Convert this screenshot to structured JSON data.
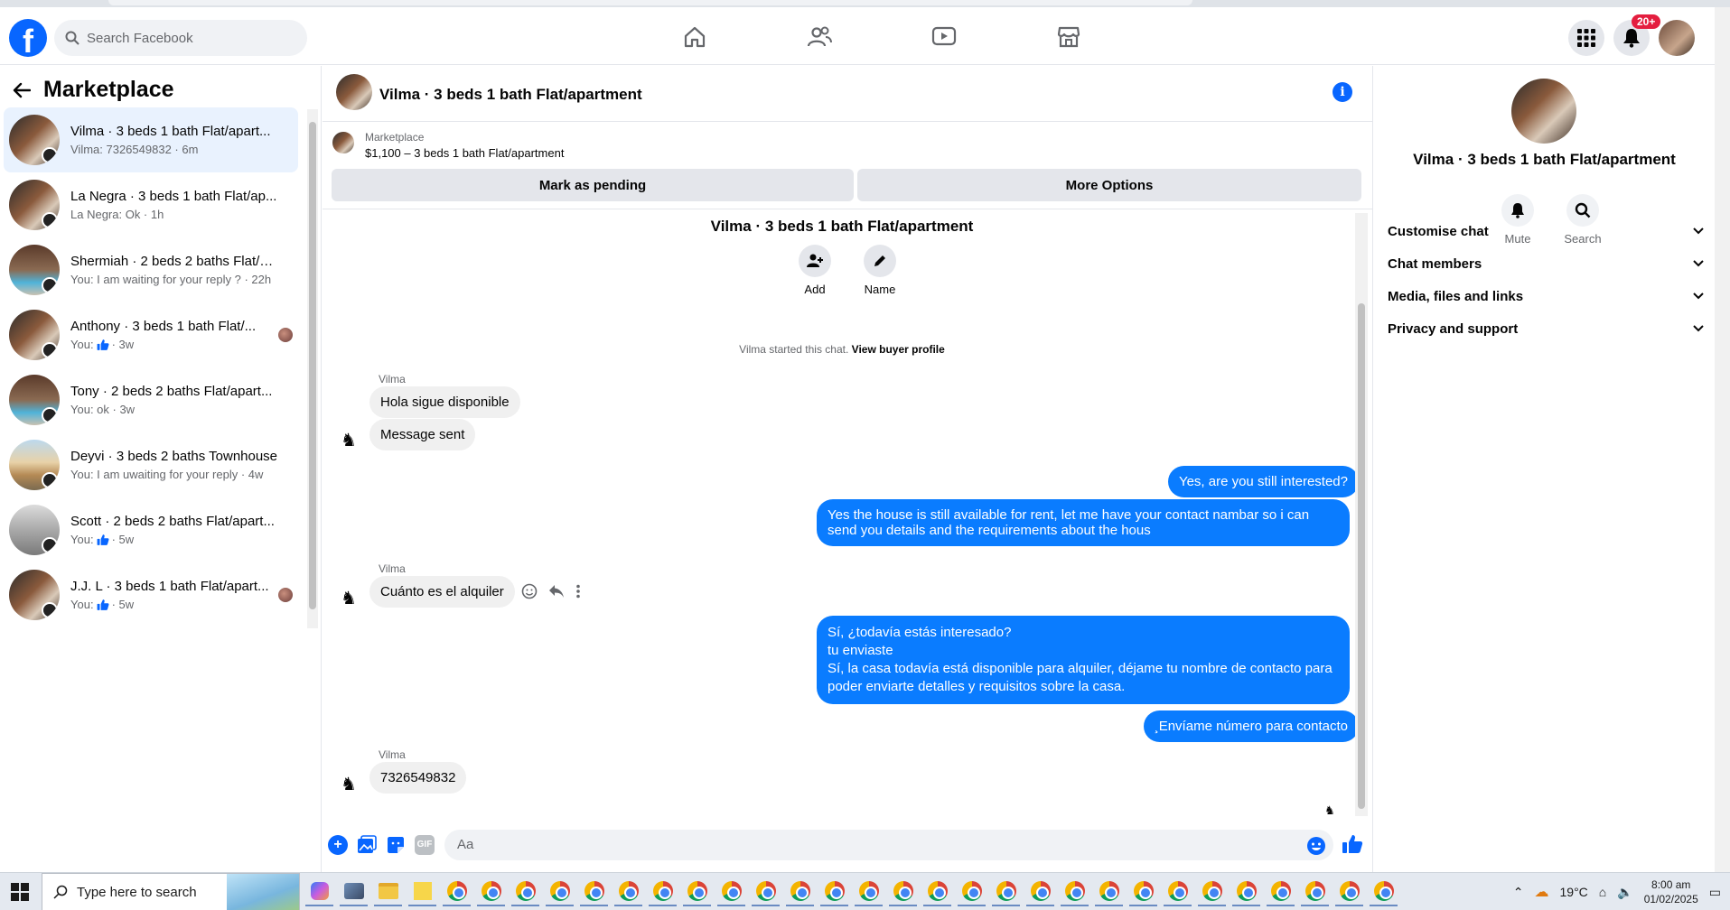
{
  "header": {
    "search_placeholder": "Search Facebook",
    "notif_badge": "20+"
  },
  "left": {
    "title": "Marketplace",
    "conversations": [
      {
        "name": "Vilma · 3 beds 1 bath Flat/apart...",
        "sub": "Vilma: 7326549832 · 6m",
        "active": true
      },
      {
        "name": "La Negra · 3 beds 1 bath Flat/ap...",
        "sub": "La Negra: Ok · 1h"
      },
      {
        "name": "Shermiah · 2 beds 2 baths Flat/a...",
        "sub": "You: I am waiting for your reply ? · 22h"
      },
      {
        "name": "Anthony · 3 beds 1 bath Flat/...",
        "sub_prefix": "You:",
        "sub": "· 3w"
      },
      {
        "name": "Tony · 2 beds 2 baths Flat/apart...",
        "sub": "You: ok · 3w"
      },
      {
        "name": "Deyvi · 3 beds 2 baths Townhouse",
        "sub": "You: I am uwaiting for your reply · 4w"
      },
      {
        "name": "Scott · 2 beds 2 baths Flat/apart...",
        "sub_prefix": "You:",
        "sub": "· 5w"
      },
      {
        "name": "J.J. L · 3 beds 1 bath Flat/apart...",
        "sub_prefix": "You:",
        "sub": "· 5w"
      }
    ]
  },
  "chat": {
    "title": "Vilma · 3 beds 1 bath Flat/apartment",
    "marketplace_label": "Marketplace",
    "listing": "$1,100 – 3 beds 1 bath Flat/apartment",
    "mark_pending": "Mark as pending",
    "more_options": "More Options",
    "center_title": "Vilma · 3 beds 1 bath Flat/apartment",
    "add_label": "Add",
    "name_label": "Name",
    "started": "Vilma started this chat.",
    "view_buyer": "View buyer profile",
    "sender": "Vilma",
    "msg1": "Hola sigue disponible",
    "msg2": "Message sent",
    "out1": "Yes, are you still interested?",
    "out2": "Yes the house is still available for rent, let me have your contact nambar so i can send you details and the requirements about the hous",
    "msg3": "Cuánto es el alquiler",
    "out3_l1": "Sí, ¿todavía estás interesado?",
    "out3_l2": "tu enviaste",
    "out3_l3": "Sí, la casa todavía está disponible para alquiler, déjame tu nombre de contacto para poder enviarte detalles y requisitos sobre la casa.",
    "out4": "¸Envíame número para contacto",
    "msg4": "7326549832",
    "composer_placeholder": "Aa",
    "gif_label": "GIF"
  },
  "right": {
    "title": "Vilma · 3 beds 1 bath Flat/apartment",
    "mute": "Mute",
    "search": "Search",
    "items": [
      "Customise chat",
      "Chat members",
      "Media, files and links",
      "Privacy and support"
    ]
  },
  "taskbar": {
    "search_placeholder": "Type here to search",
    "temp": "19°C",
    "time": "8:00 am",
    "date": "01/02/2025"
  },
  "colors": {
    "accent": "#0866ff",
    "outgoing_bubble": "#0a7cff",
    "active_row": "#e9f2fe"
  }
}
